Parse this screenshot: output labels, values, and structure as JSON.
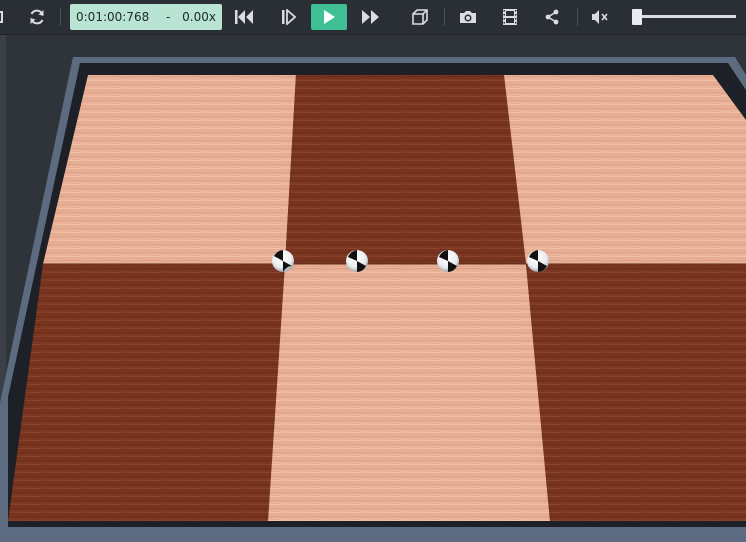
{
  "toolbar": {
    "time": "0:01:00:768",
    "separator": "-",
    "rate": "0.00x",
    "volume_level": 0.02,
    "icons": {
      "reset": "reset-icon",
      "loop": "loop-icon",
      "rewind": "skip-to-start-icon",
      "step": "step-forward-icon",
      "play": "play-icon",
      "fast_forward": "fast-forward-icon",
      "view3d": "cube-icon",
      "screenshot": "camera-icon",
      "record": "film-icon",
      "share": "share-icon",
      "mute": "mute-icon"
    }
  },
  "colors": {
    "toolbar_bg": "#2a2e35",
    "time_box_bg": "#b9e3d2",
    "play_accent": "#3fbf94",
    "light_wood": "#e8b096",
    "dark_wood": "#7a3520",
    "frame": "#6a7a92"
  },
  "scene": {
    "board": "2x3 checkerboard floor with alternating light and dark wood tiles",
    "balls": 4
  }
}
